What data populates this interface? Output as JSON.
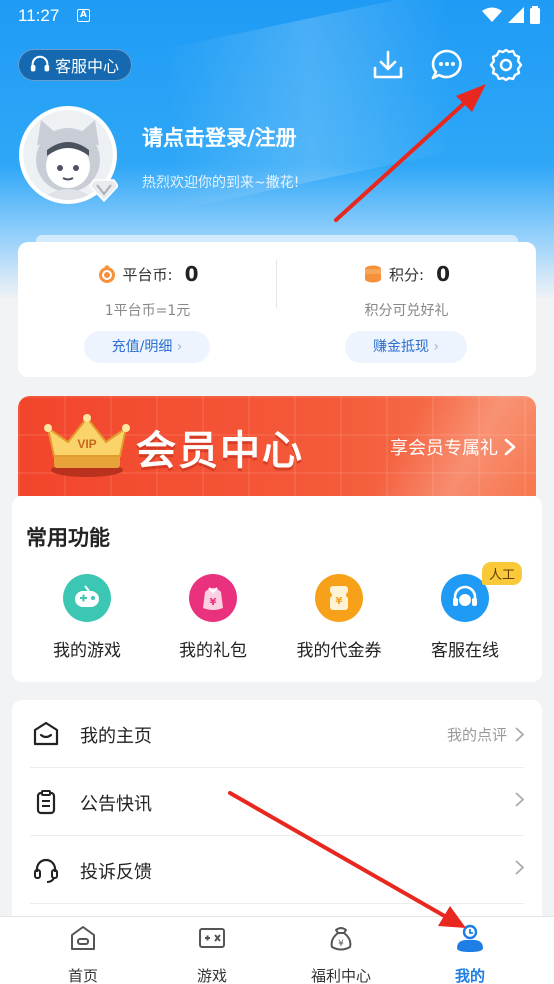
{
  "status_bar": {
    "time": "11:27",
    "notification_letter": "A"
  },
  "header": {
    "customer_service_label": "客服中心",
    "login_prompt": "请点击登录/注册",
    "welcome_text": "热烈欢迎你的到来~撒花!"
  },
  "wallet": {
    "platform_coin": {
      "label": "平台币:",
      "value": "0",
      "note": "1平台币=1元",
      "button": "充值/明细"
    },
    "points": {
      "label": "积分:",
      "value": "0",
      "note": "积分可兑好礼",
      "button": "赚金抵现"
    }
  },
  "vip": {
    "title": "会员中心",
    "link": "享会员专属礼",
    "crown_text": "VIP"
  },
  "functions": {
    "heading": "常用功能",
    "items": [
      {
        "label": "我的游戏"
      },
      {
        "label": "我的礼包"
      },
      {
        "label": "我的代金券"
      },
      {
        "label": "客服在线",
        "badge": "人工"
      }
    ]
  },
  "menu": [
    {
      "label": "我的主页",
      "right_text": "我的点评"
    },
    {
      "label": "公告快讯",
      "right_text": ""
    },
    {
      "label": "投诉反馈",
      "right_text": ""
    }
  ],
  "tabbar": [
    {
      "label": "首页"
    },
    {
      "label": "游戏"
    },
    {
      "label": "福利中心"
    },
    {
      "label": "我的"
    }
  ],
  "colors": {
    "hero_blue": "#1f9bf5",
    "accent_blue": "#1e7ee6",
    "vip_red": "#f2452c",
    "arrow_red": "#e8281e"
  }
}
